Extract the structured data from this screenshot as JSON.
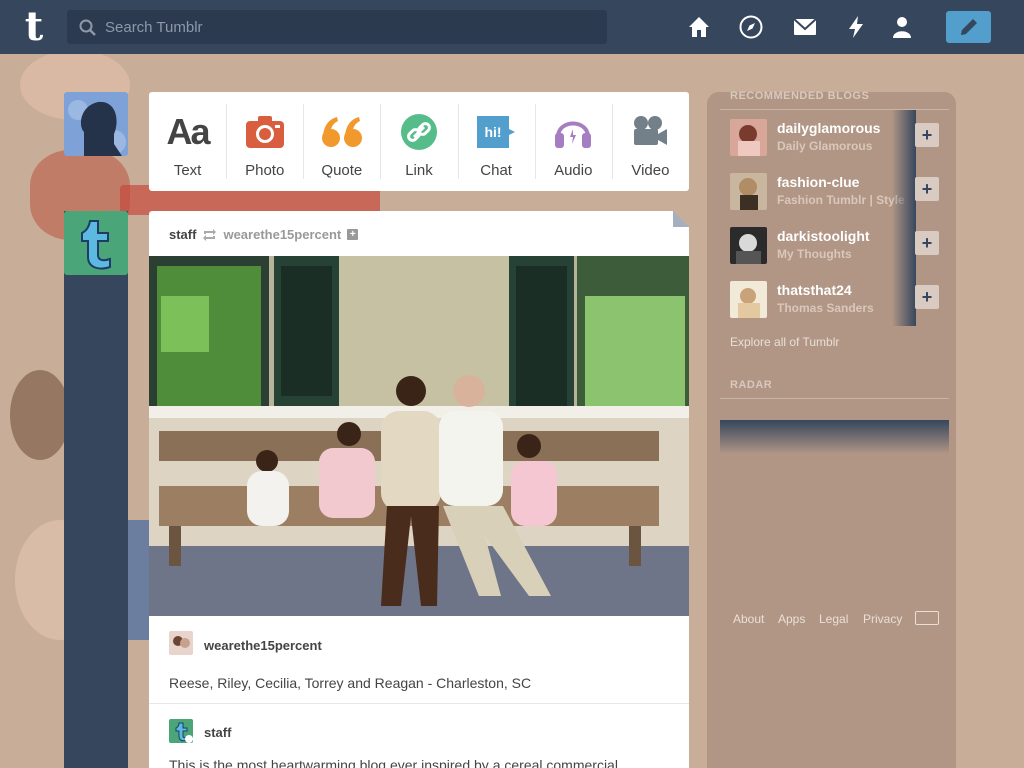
{
  "header": {
    "search_placeholder": "Search Tumblr",
    "logo_letter": "t",
    "nav": [
      "home-icon",
      "explore-icon",
      "inbox-icon",
      "activity-icon",
      "account-icon"
    ],
    "compose_icon": "pencil-icon",
    "colors": {
      "bar": "#36465d",
      "compose": "#529ecc"
    }
  },
  "post_types": [
    {
      "label": "Text",
      "icon": "Aa",
      "color": "#444444"
    },
    {
      "label": "Photo",
      "icon": "camera-icon",
      "color": "#d95e40"
    },
    {
      "label": "Quote",
      "icon": "“",
      "color": "#f2992e"
    },
    {
      "label": "Link",
      "icon": "link-icon",
      "color": "#56bc8a"
    },
    {
      "label": "Chat",
      "icon": "hi!",
      "color": "#529ecc"
    },
    {
      "label": "Audio",
      "icon": "headphones-icon",
      "color": "#a77dc2"
    },
    {
      "label": "Video",
      "icon": "video-camera-icon",
      "color": "#748089"
    }
  ],
  "post": {
    "author": "staff",
    "reblogged_from": "wearethe15percent",
    "caption_author": "wearethe15percent",
    "caption": "Reese, Riley, Cecilia, Torrey and Reagan - Charleston, SC",
    "reblog_author": "staff",
    "reblog_text": "This is the most heartwarming blog ever inspired by a cereal commercial"
  },
  "sidebar": {
    "recommended_title": "RECOMMENDED BLOGS",
    "recommended": [
      {
        "name": "dailyglamorous",
        "title": "Daily Glamorous"
      },
      {
        "name": "fashion-clue",
        "title": "Fashion Tumblr | Style"
      },
      {
        "name": "darkistoolight",
        "title": "My Thoughts"
      },
      {
        "name": "thatsthat24",
        "title": "Thomas Sanders"
      }
    ],
    "explore": "Explore all of Tumblr",
    "radar_title": "RADAR",
    "footer": {
      "about": "About",
      "apps": "Apps",
      "legal": "Legal",
      "privacy": "Privacy"
    }
  }
}
